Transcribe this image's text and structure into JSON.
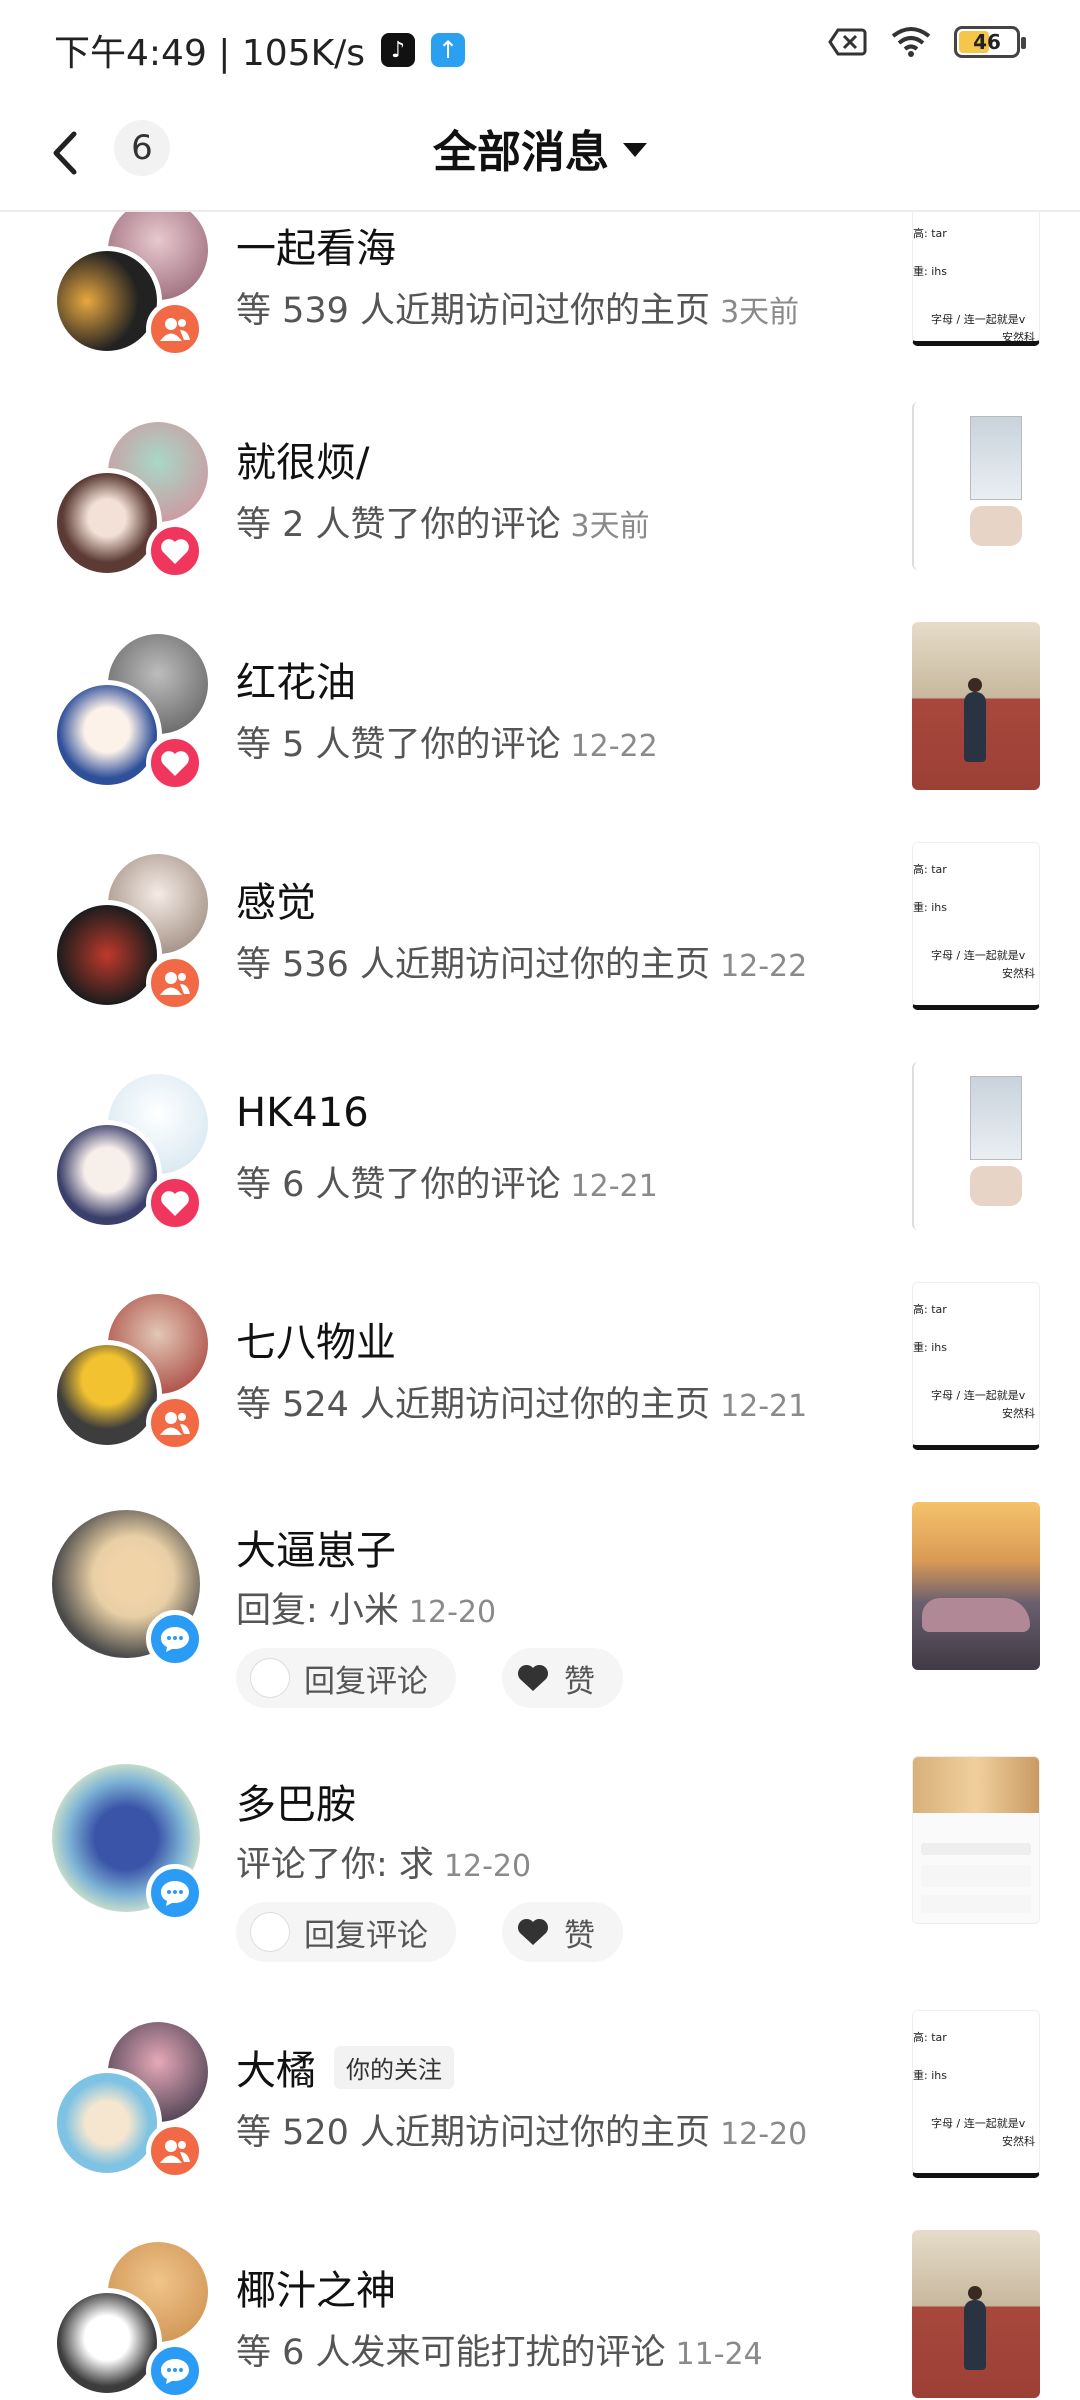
{
  "status_bar": {
    "text": "下午4:49 | 105K/s",
    "battery": "46"
  },
  "header": {
    "unread_count": "6",
    "title": "全部消息"
  },
  "messages": [
    {
      "name": "一起看海",
      "desc": "等 539 人近期访问过你的主页",
      "time": "3天前",
      "type": "follow",
      "thumb": "doc"
    },
    {
      "name": "就很烦/",
      "desc": "等 2 人赞了你的评论",
      "time": "3天前",
      "type": "like",
      "thumb": "phone"
    },
    {
      "name": "红花油",
      "desc": "等 5 人赞了你的评论",
      "time": "12-22",
      "type": "like",
      "thumb": "gym"
    },
    {
      "name": "感觉",
      "desc": "等 536 人近期访问过你的主页",
      "time": "12-22",
      "type": "follow",
      "thumb": "doc"
    },
    {
      "name": "HK416",
      "desc": "等 6 人赞了你的评论",
      "time": "12-21",
      "type": "like",
      "thumb": "phone"
    },
    {
      "name": "七八物业",
      "desc": "等 524 人近期访问过你的主页",
      "time": "12-21",
      "type": "follow",
      "thumb": "doc"
    },
    {
      "name": "大逼崽子",
      "desc": "回复: 小米",
      "time": "12-20",
      "type": "comment",
      "thumb": "car"
    },
    {
      "name": "多巴胺",
      "desc": "评论了你: 求",
      "time": "12-20",
      "type": "comment",
      "thumb": "dog"
    },
    {
      "name": "大橘",
      "tag": "你的关注",
      "desc": "等 520 人近期访问过你的主页",
      "time": "12-20",
      "type": "follow",
      "thumb": "doc"
    },
    {
      "name": "椰汁之神",
      "desc": "等 6 人发来可能打扰的评论",
      "time": "11-24",
      "type": "comment",
      "thumb": "gym"
    }
  ],
  "actions": {
    "reply_label": "回复评论",
    "like_label": "赞"
  },
  "thumb_doc_text": {
    "l1": "高: tar",
    "l2": "重: ihs",
    "l3": "字母 / 连一起就是v",
    "l4": "安然科"
  },
  "colors": {
    "follow": "#f26a45",
    "like": "#f0365c",
    "comment": "#2b9cf6"
  }
}
